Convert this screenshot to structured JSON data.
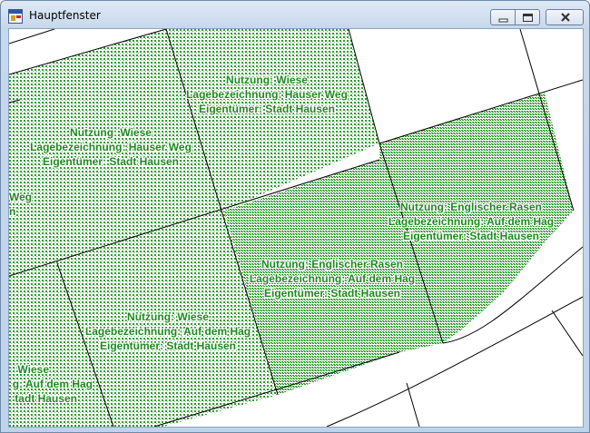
{
  "window": {
    "title": "Hauptfenster",
    "controls": [
      "minimize-icon",
      "maximize-icon",
      "close-icon"
    ]
  },
  "colors": {
    "parcel_fill": "#2e9a2e",
    "parcel_light_fill": "#7cc47c",
    "line": "#000000",
    "label": "#1d8a1d"
  },
  "parcels": [
    {
      "nutzung": "Nutzung: Wiese",
      "lage": "Lagebezeichnung: Hauser Weg",
      "eigentuemer": "Eigentümer: Stadt Hausen"
    },
    {
      "nutzung": "Nutzung: Wiese",
      "lage": "Lagebezeichnung: Hauser Weg",
      "eigentuemer": "Eigentümer: Stadt Hausen"
    },
    {
      "nutzung": "Nutzung: Englischer Rasen",
      "lage": "Lagebezeichnung: Auf dem Hag",
      "eigentuemer": "Eigentümer: Stadt Hausen"
    },
    {
      "nutzung": "Nutzung: Englischer Rasen",
      "lage": "Lagebezeichnung: Auf dem Hag",
      "eigentuemer": "Eigentümer: Stadt Hausen"
    },
    {
      "nutzung": "Nutzung: Wiese",
      "lage": "Lagebezeichnung: Auf dem Hag",
      "eigentuemer": "Eigentümer: Stadt Hausen"
    },
    {
      "nutzung": "Weg",
      "lage": "n",
      "eigentuemer": ""
    },
    {
      "nutzung": "Wiese",
      "lage": "g: Auf dem Hag",
      "eigentuemer": "tadt Hausen"
    }
  ]
}
